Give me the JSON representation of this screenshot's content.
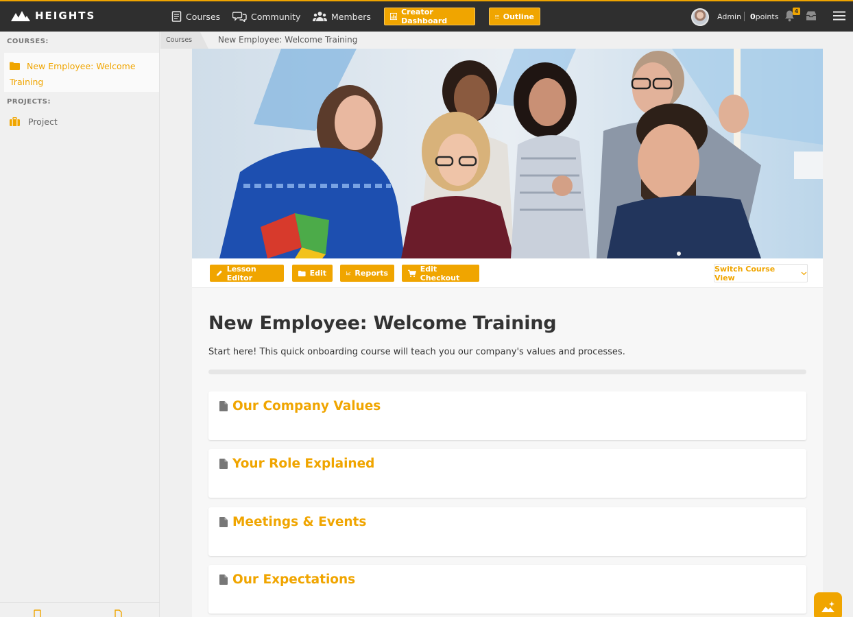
{
  "brand": {
    "name": "HEIGHTS"
  },
  "nav": {
    "courses": "Courses",
    "community": "Community",
    "members": "Members",
    "creator_dashboard": "Creator Dashboard",
    "outline": "Outline"
  },
  "user": {
    "name": "Admin",
    "points_value": "0",
    "points_label": "points",
    "notification_count": "4"
  },
  "sidebar": {
    "courses_heading": "COURSES:",
    "course_item": "New Employee: Welcome Training",
    "projects_heading": "PROJECTS:",
    "project_item": "Project"
  },
  "breadcrumb": {
    "root": "Courses",
    "current": "New Employee: Welcome Training"
  },
  "toolbar": {
    "lesson_editor": "Lesson Editor",
    "edit": "Edit",
    "reports": "Reports",
    "edit_checkout": "Edit Checkout",
    "switch_view": "Switch Course View"
  },
  "course": {
    "title": "New Employee: Welcome Training",
    "description": "Start here! This quick onboarding course will teach you our company's values and processes.",
    "progress_percent": 0,
    "lessons": [
      {
        "title": "Our Company Values"
      },
      {
        "title": "Your Role Explained"
      },
      {
        "title": "Meetings & Events"
      },
      {
        "title": "Our Expectations"
      }
    ]
  },
  "colors": {
    "accent": "#f0a500",
    "topbar": "#2f2f2f",
    "background": "#f0f0f0"
  },
  "icons": {
    "logo": "mountain-icon",
    "lesson": "document-icon",
    "sidebar_course": "folder-icon",
    "sidebar_project": "briefcase-icon",
    "fab": "sparkle-image-icon"
  }
}
